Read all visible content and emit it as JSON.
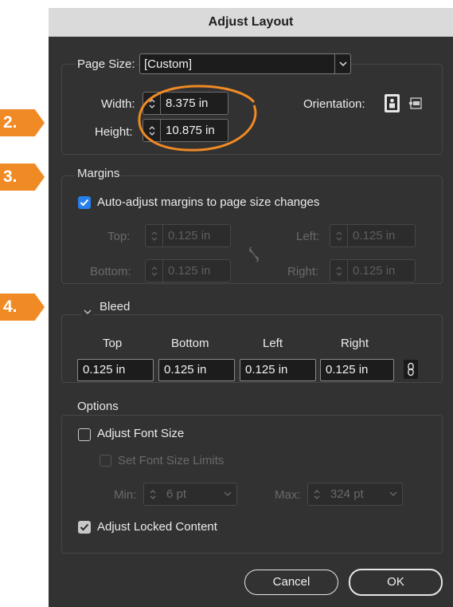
{
  "dialog": {
    "title": "Adjust Layout"
  },
  "markers": [
    "2.",
    "3.",
    "4."
  ],
  "page_size": {
    "label": "Page Size:",
    "value": "[Custom]",
    "width_label": "Width:",
    "width_value": "8.375 in",
    "height_label": "Height:",
    "height_value": "10.875 in",
    "orientation_label": "Orientation:"
  },
  "margins": {
    "header": "Margins",
    "auto_adjust_label": "Auto-adjust margins to page size changes",
    "auto_adjust_checked": true,
    "top_label": "Top:",
    "top_value": "0.125 in",
    "bottom_label": "Bottom:",
    "bottom_value": "0.125 in",
    "left_label": "Left:",
    "left_value": "0.125 in",
    "right_label": "Right:",
    "right_value": "0.125 in"
  },
  "bleed": {
    "header": "Bleed",
    "columns": [
      "Top",
      "Bottom",
      "Left",
      "Right"
    ],
    "values": [
      "0.125 in",
      "0.125 in",
      "0.125 in",
      "0.125 in"
    ]
  },
  "options": {
    "header": "Options",
    "adjust_font_size_label": "Adjust Font Size",
    "adjust_font_size_checked": false,
    "set_font_size_limits_label": "Set Font Size Limits",
    "min_label": "Min:",
    "min_value": "6 pt",
    "max_label": "Max:",
    "max_value": "324 pt",
    "adjust_locked_content_label": "Adjust Locked Content",
    "adjust_locked_content_checked": true
  },
  "buttons": {
    "cancel": "Cancel",
    "ok": "OK"
  },
  "colors": {
    "dialog_bg": "#323232",
    "titlebar_bg": "#dadada",
    "accent_blue": "#2680eb",
    "marker_orange": "#f08a24"
  },
  "icons": [
    "chevron-down-icon",
    "stepper-arrows-icon",
    "portrait-orientation-icon",
    "landscape-orientation-icon",
    "chain-link-broken-icon",
    "chain-link-icon",
    "checkmark-icon"
  ]
}
